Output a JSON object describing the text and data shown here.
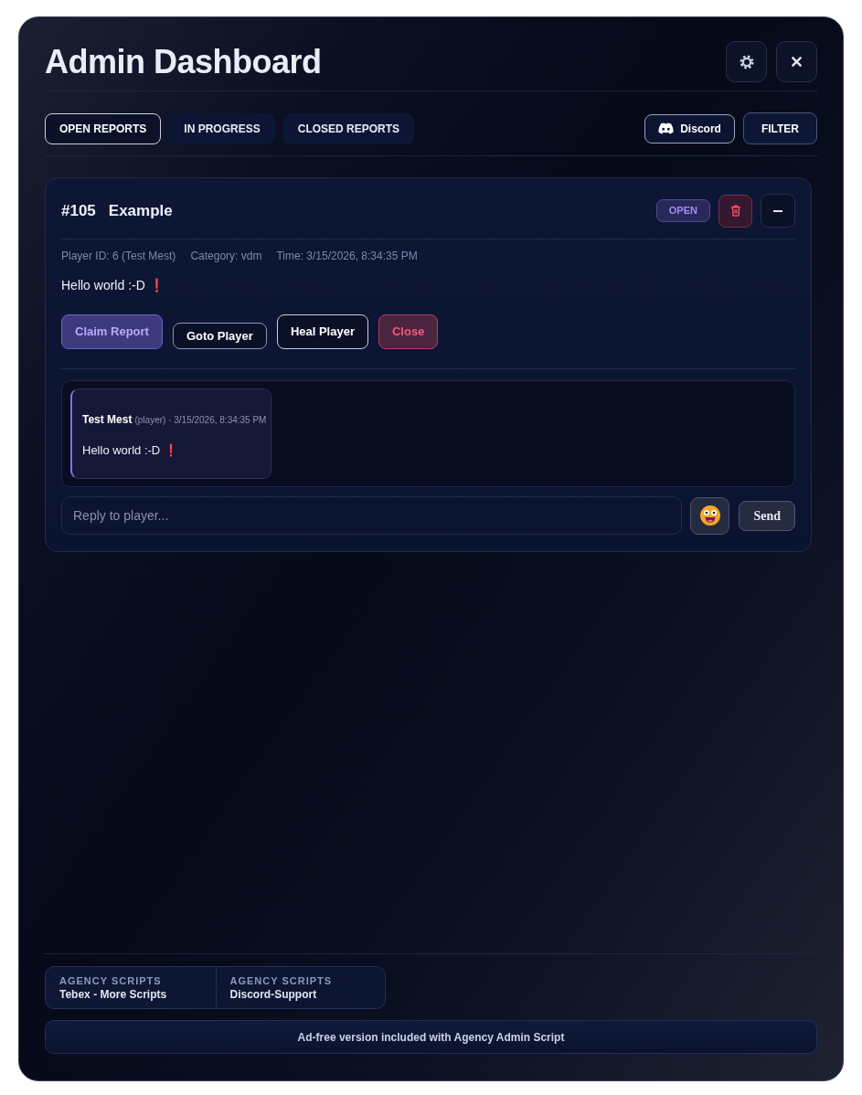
{
  "window": {
    "title": "Admin Dashboard"
  },
  "tabs": [
    {
      "label": "OPEN REPORTS",
      "selected": true
    },
    {
      "label": "IN PROGRESS",
      "selected": false
    },
    {
      "label": "CLOSED REPORTS",
      "selected": false
    }
  ],
  "toolbar": {
    "discord_button": "Discord",
    "filter_button": "FILTER"
  },
  "reports": [
    {
      "number": "#105",
      "title": "Example",
      "status": "OPEN",
      "meta": [
        "Player ID: 6 (Test Mest)",
        "Category: vdm",
        "Time: 3/15/2026, 8:34:35 PM"
      ],
      "message": "Hello world :-D ❗",
      "actions": [
        {
          "label": "Claim Report",
          "kind": "accent"
        },
        {
          "label": "Goto Player",
          "kind": "compact"
        },
        {
          "label": "Heal Player",
          "kind": "outline"
        },
        {
          "label": "Close",
          "kind": "danger"
        }
      ],
      "chat": [
        {
          "author": "Test Mest",
          "detail": "(player) · 3/15/2026, 8:34:35 PM",
          "text": "Hello world :-D ❗"
        }
      ],
      "reply": {
        "placeholder": "Reply to player..."
      },
      "send_button": "Send"
    }
  ],
  "footer": {
    "links": [
      {
        "label": "AGENCY SCRIPTS",
        "title": "Tebex - More Scripts"
      },
      {
        "label": "AGENCY SCRIPTS",
        "title": "Discord-Support"
      }
    ],
    "notice": "Ad-free version included with Agency Admin Script"
  }
}
